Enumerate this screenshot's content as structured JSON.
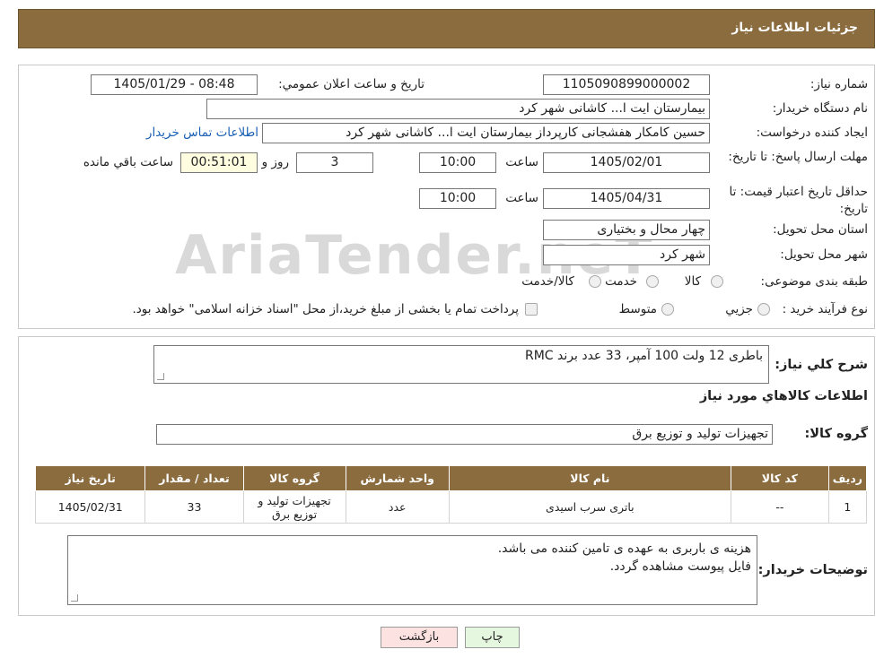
{
  "header": {
    "title": "جزئیات اطلاعات نیاز"
  },
  "watermark": {
    "text": "AriaTender.neT"
  },
  "form": {
    "need_number": {
      "label": "شماره نیاز:",
      "value": "1105090899000002"
    },
    "announce_date": {
      "label": "تاریخ و ساعت اعلان عمومي:",
      "value": "1405/01/29 - 08:48"
    },
    "buyer_org": {
      "label": "نام دستگاه خریدار:",
      "value": "بیمارستان ایت ا... کاشانی شهر کرد"
    },
    "requester": {
      "label": "ایجاد کننده درخواست:",
      "value": "حسین کامکار هفشجانی کارپرداز بیمارستان ایت ا... کاشانی شهر کرد",
      "contact_link": "اطلاعات تماس خریدار"
    },
    "response_deadline": {
      "label": "مهلت ارسال پاسخ: تا تاریخ:",
      "date": "1405/02/01",
      "time_label": "ساعت",
      "time": "10:00",
      "days": "3",
      "days_label": "روز و",
      "remaining": "00:51:01",
      "remaining_label": "ساعت باقي مانده"
    },
    "price_validity": {
      "label": "حداقل تاریخ اعتبار قیمت: تا تاریخ:",
      "date": "1405/04/31",
      "time_label": "ساعت",
      "time": "10:00"
    },
    "province": {
      "label": "استان محل تحویل:",
      "value": "چهار محال و بختیاری"
    },
    "city": {
      "label": "شهر محل تحویل:",
      "value": "شهر کرد"
    },
    "category": {
      "label": "طبقه بندی موضوعی:",
      "options": [
        "کالا",
        "خدمت",
        "کالا/خدمت"
      ]
    },
    "process_type": {
      "label": "نوع فرآیند خرید :",
      "options": [
        "جزیي",
        "متوسط"
      ],
      "note": "پرداخت تمام یا بخشی از مبلغ خرید،از محل \"اسناد خزانه اسلامی\" خواهد بود."
    }
  },
  "description": {
    "label": "شرح کلي نياز:",
    "value": "باطری 12 ولت 100 آمپر،  33 عدد برند RMC"
  },
  "goods_section": {
    "title": "اطلاعات کالاهاي مورد نياز",
    "group_label": "گروه کالا:",
    "group_value": "تجهیزات تولید و توزیع برق",
    "table": {
      "headers": [
        "رديف",
        "کد کالا",
        "نام کالا",
        "واحد شمارش",
        "گروه کالا",
        "تعداد / مقدار",
        "تاريخ نياز"
      ],
      "rows": [
        [
          "1",
          "--",
          "باتری سرب اسیدی",
          "عدد",
          "تجهیزات تولید و توزیع برق",
          "33",
          "1405/02/31"
        ]
      ]
    },
    "buyer_notes_label": "توضیحات خریدار:",
    "buyer_notes_line1": "هزینه ی باربری به عهده ی تامین کننده می باشد.",
    "buyer_notes_line2": "فایل پیوست مشاهده گردد."
  },
  "buttons": {
    "print": "چاپ",
    "back": "بازگشت"
  },
  "colors": {
    "header_bg": "#8b6c3f",
    "back_btn_bg": "#fde2e2",
    "print_btn_bg": "#e6f7e0"
  }
}
